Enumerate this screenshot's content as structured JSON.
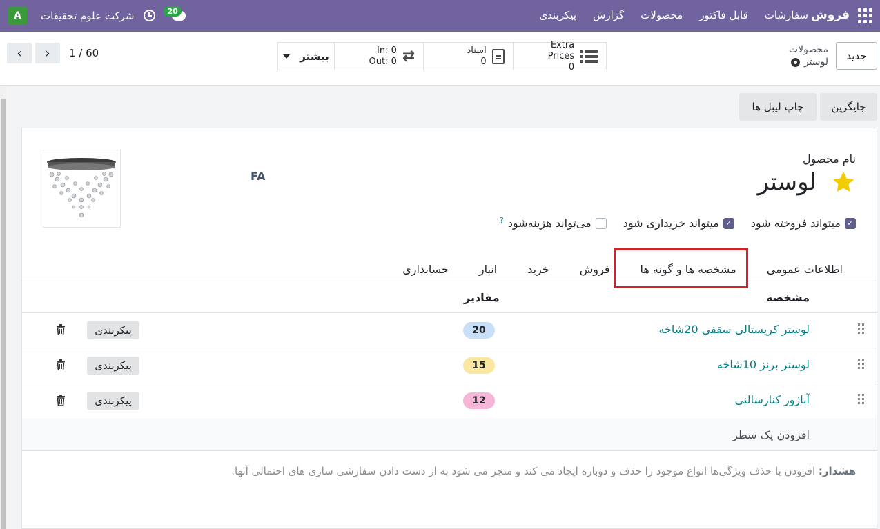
{
  "navbar": {
    "app_name": "فروش",
    "menu": [
      "سفارشات",
      "قابل فاکتور",
      "محصولات",
      "گزارش",
      "پیکربندی"
    ],
    "company": "شرکت علوم تحقیقات",
    "avatar_letter": "A",
    "chat_count": "20",
    "bg_color": "#71639e"
  },
  "control": {
    "new_button": "جدید",
    "breadcrumb_parent": "محصولات",
    "breadcrumb_current": "لوستر",
    "stats": {
      "extra_prices_label": "Extra Prices",
      "extra_prices_value": "0",
      "documents_label": "اسناد",
      "documents_value": "0",
      "in_line": "In: 0",
      "out_line": "Out: 0",
      "more_label": "بیشتر"
    },
    "pager": "1 / 60"
  },
  "actions": {
    "replace": "جایگزین",
    "print_labels": "چاپ لیبل ها"
  },
  "product": {
    "name_label": "نام محصول",
    "name": "لوستر",
    "lang_tag": "FA",
    "checkboxes": [
      {
        "label": "میتواند فروخته شود",
        "checked": true
      },
      {
        "label": "میتواند خریداری شود",
        "checked": true
      },
      {
        "label": "می‌تواند هزینه‌شود",
        "checked": false
      }
    ],
    "help_mark": "?"
  },
  "tabs": [
    "اطلاعات عمومی",
    "مشخصه ها و گونه ها",
    "فروش",
    "خرید",
    "انبار",
    "حسابداری"
  ],
  "table": {
    "col_attribute": "مشخصه",
    "col_values": "مقادیر",
    "rows": [
      {
        "attribute": "لوستر کریستالی سقفی 20شاخه",
        "value": "20",
        "pill_color": "#c9dff7",
        "config": "پیکربندی"
      },
      {
        "attribute": "لوستر برنز 10شاخه",
        "value": "15",
        "pill_color": "#fbe7a1",
        "config": "پیکربندی"
      },
      {
        "attribute": "آباژور کنارسالنی",
        "value": "12",
        "pill_color": "#f7b6d8",
        "config": "پیکربندی"
      }
    ],
    "add_line": "افزودن یک سطر"
  },
  "warning": {
    "title": "هشدار:",
    "text": "افزودن یا حذف ویژگی‌ها انواع موجود را حذف و دوباره ایجاد می کند و منجر می شود به از دست دادن سفارشی سازی های احتمالی آنها."
  }
}
